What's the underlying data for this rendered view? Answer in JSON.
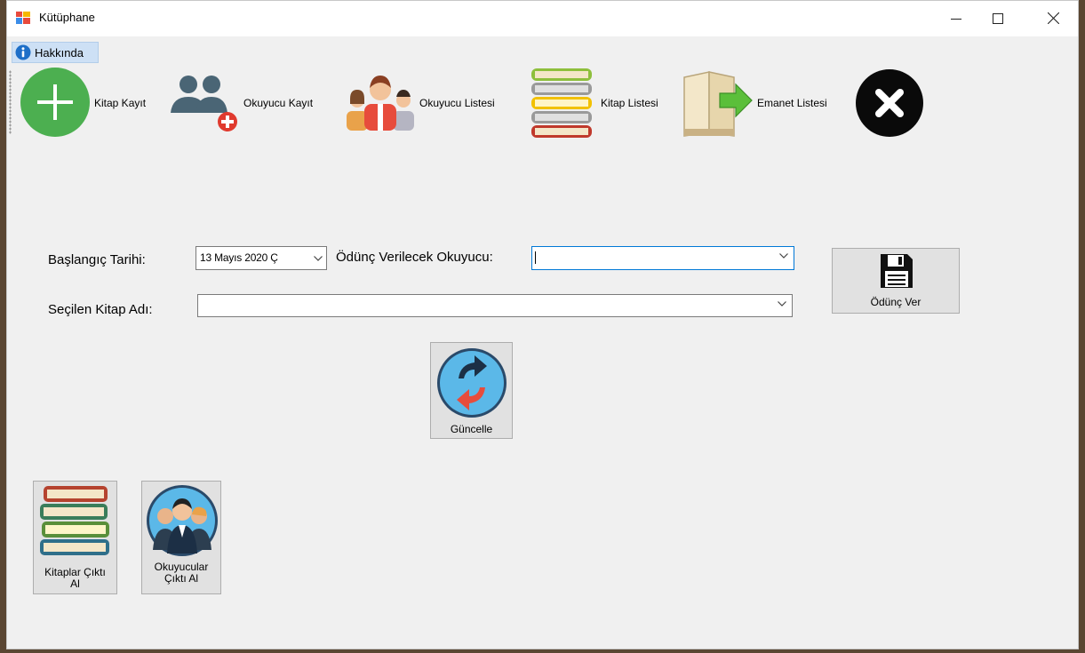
{
  "window": {
    "title": "Kütüphane"
  },
  "menu": {
    "about": "Hakkında"
  },
  "toolbar": {
    "items": [
      {
        "label": "Kitap Kayıt",
        "icon": "add-circle-icon"
      },
      {
        "label": "Okuyucu Kayıt",
        "icon": "add-user-icon"
      },
      {
        "label": "Okuyucu Listesi",
        "icon": "people-group-icon"
      },
      {
        "label": "Kitap Listesi",
        "icon": "books-stack-icon"
      },
      {
        "label": "Emanet Listesi",
        "icon": "book-arrow-icon"
      },
      {
        "label": "",
        "icon": "close-circle-icon"
      }
    ]
  },
  "form": {
    "start_date_label": "Başlangıç Tarihi:",
    "start_date_value": "13  Mayıs  2020 Ç",
    "reader_label": "Ödünç Verilecek Okuyucu:",
    "reader_value": "",
    "book_label": "Seçilen Kitap Adı:",
    "book_value": ""
  },
  "buttons": {
    "lend": "Ödünç Ver",
    "refresh": "Güncelle",
    "books_print": "Kitaplar Çıktı Al",
    "readers_print": "Okuyucular Çıktı Al"
  },
  "colors": {
    "add_green": "#4caf50",
    "close_black": "#0a0a0a",
    "refresh_blue": "#5bb8e8",
    "focus_blue": "#0078d7",
    "menu_highlight": "#cde0f5"
  }
}
